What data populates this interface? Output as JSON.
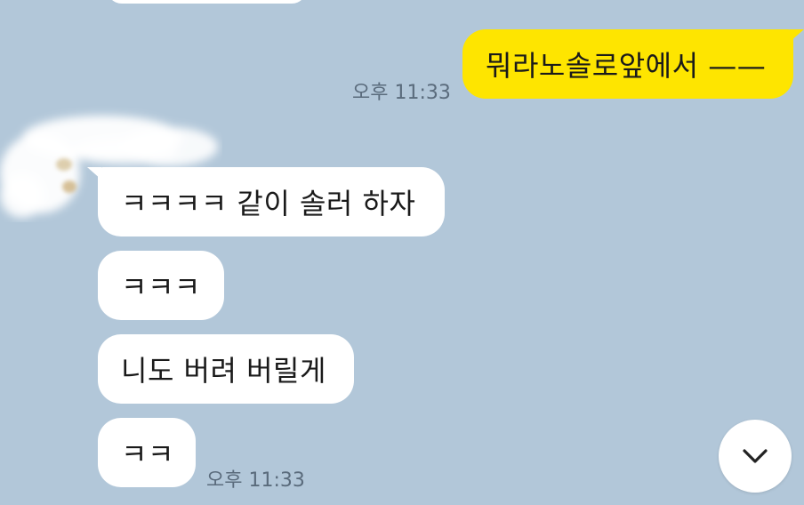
{
  "chat": {
    "prev_time": "",
    "messages": [
      {
        "id": "m1",
        "side": "out",
        "text": "뭐라노솔로앞에서 ——",
        "time": "오후 11:33"
      },
      {
        "id": "m2",
        "side": "in",
        "text": "ㅋㅋㅋㅋ 같이 솔러 하자",
        "time": ""
      },
      {
        "id": "m3",
        "side": "in",
        "text": "ㅋㅋㅋ",
        "time": ""
      },
      {
        "id": "m4",
        "side": "in",
        "text": "니도 버려 버릴게",
        "time": ""
      },
      {
        "id": "m5",
        "side": "in",
        "text": "ㅋㅋ",
        "time": "오후 11:33"
      }
    ]
  },
  "colors": {
    "background": "#b2c7d9",
    "incoming_bubble": "#ffffff",
    "outgoing_bubble": "#fee500",
    "timestamp": "#5a6b7c"
  },
  "icons": {
    "scroll_down": "chevron-down-icon",
    "profile": "blurred-avatar"
  }
}
